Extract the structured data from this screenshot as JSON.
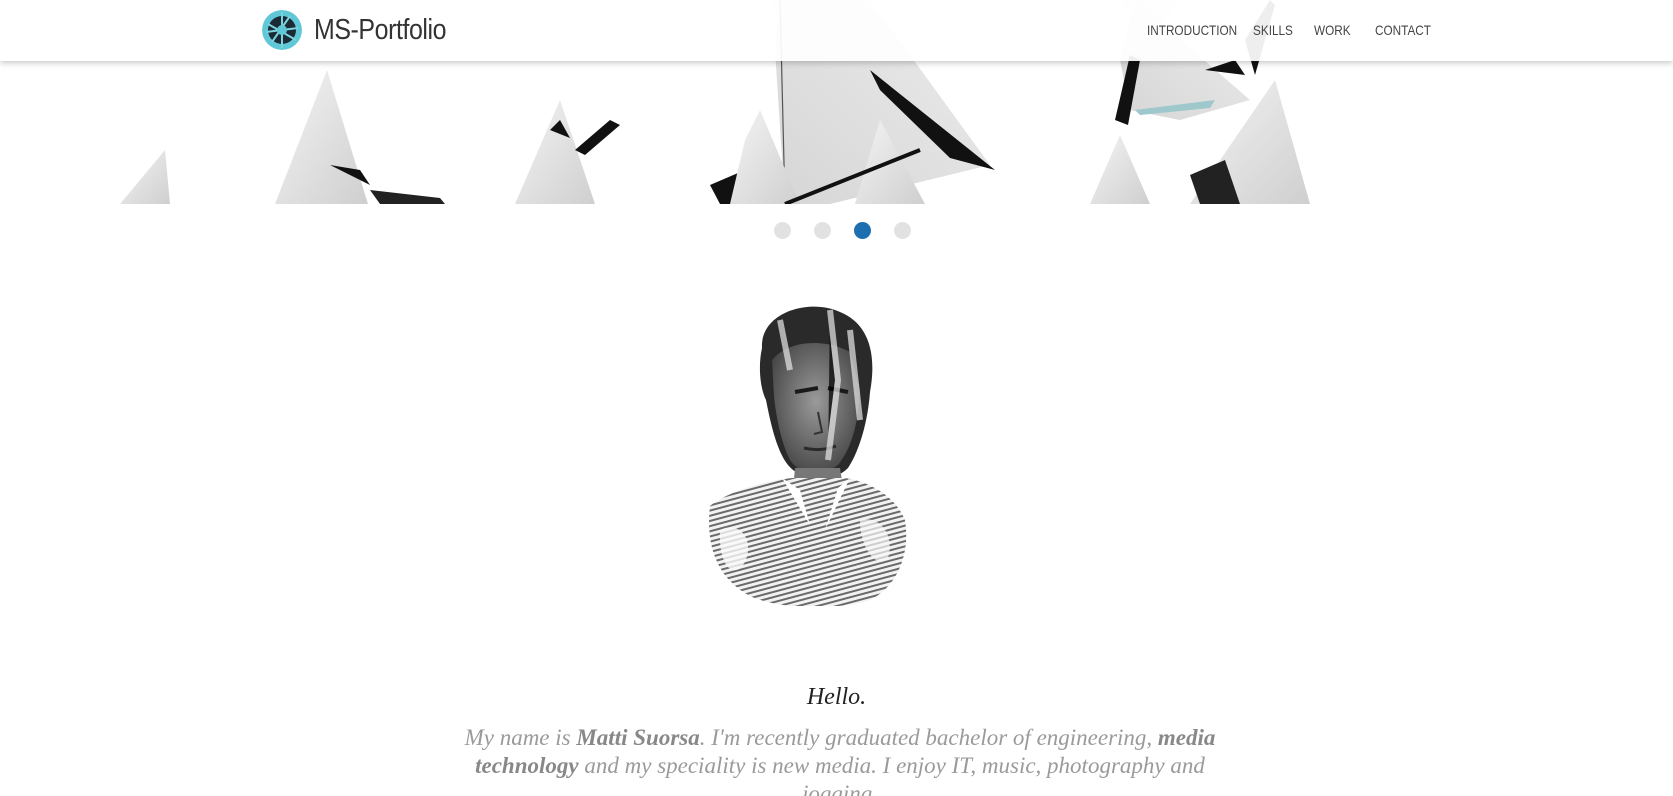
{
  "header": {
    "brand_title": "MS-Portfolio",
    "logo_icon": "ms-logo-icon"
  },
  "nav": {
    "items": [
      {
        "label": "INTRODUCTION"
      },
      {
        "label": "SKILLS"
      },
      {
        "label": "WORK"
      },
      {
        "label": "CONTACT"
      }
    ]
  },
  "slider": {
    "slide_count": 4,
    "active_index": 2
  },
  "intro": {
    "greeting": "Hello.",
    "text_1": "My name is ",
    "name": "Matti Suorsa",
    "text_2": ". I'm recently graduated bachelor of engineering, ",
    "field": "media technology",
    "text_3": " and my speciality is new media. I enjoy IT, music, photography and jogging."
  },
  "colors": {
    "accent": "#1e6fb0",
    "dot_inactive": "#e2e2e2",
    "intro_text": "#9a9a9a"
  }
}
